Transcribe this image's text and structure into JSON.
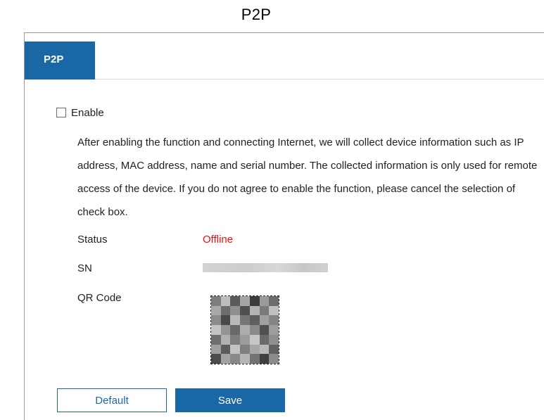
{
  "document": {
    "title": "P2P"
  },
  "tabs": [
    {
      "label": "P2P",
      "active": true
    }
  ],
  "enable": {
    "label": "Enable",
    "checked": false
  },
  "notice": "After enabling the function and connecting Internet, we will collect device information such as IP address, MAC address, name and serial number. The collected information is only used for remote access of the device. If you do not agree to enable the function, please cancel the selection of check box.",
  "fields": {
    "status": {
      "label": "Status",
      "value": "Offline",
      "value_color": "#f20d0d"
    },
    "sn": {
      "label": "SN",
      "value_redacted": true
    },
    "qr_code": {
      "label": "QR Code",
      "redacted": true
    }
  },
  "buttons": {
    "default": "Default",
    "save": "Save"
  },
  "colors": {
    "accent": "#1a67a5",
    "error": "#f20d0d"
  }
}
